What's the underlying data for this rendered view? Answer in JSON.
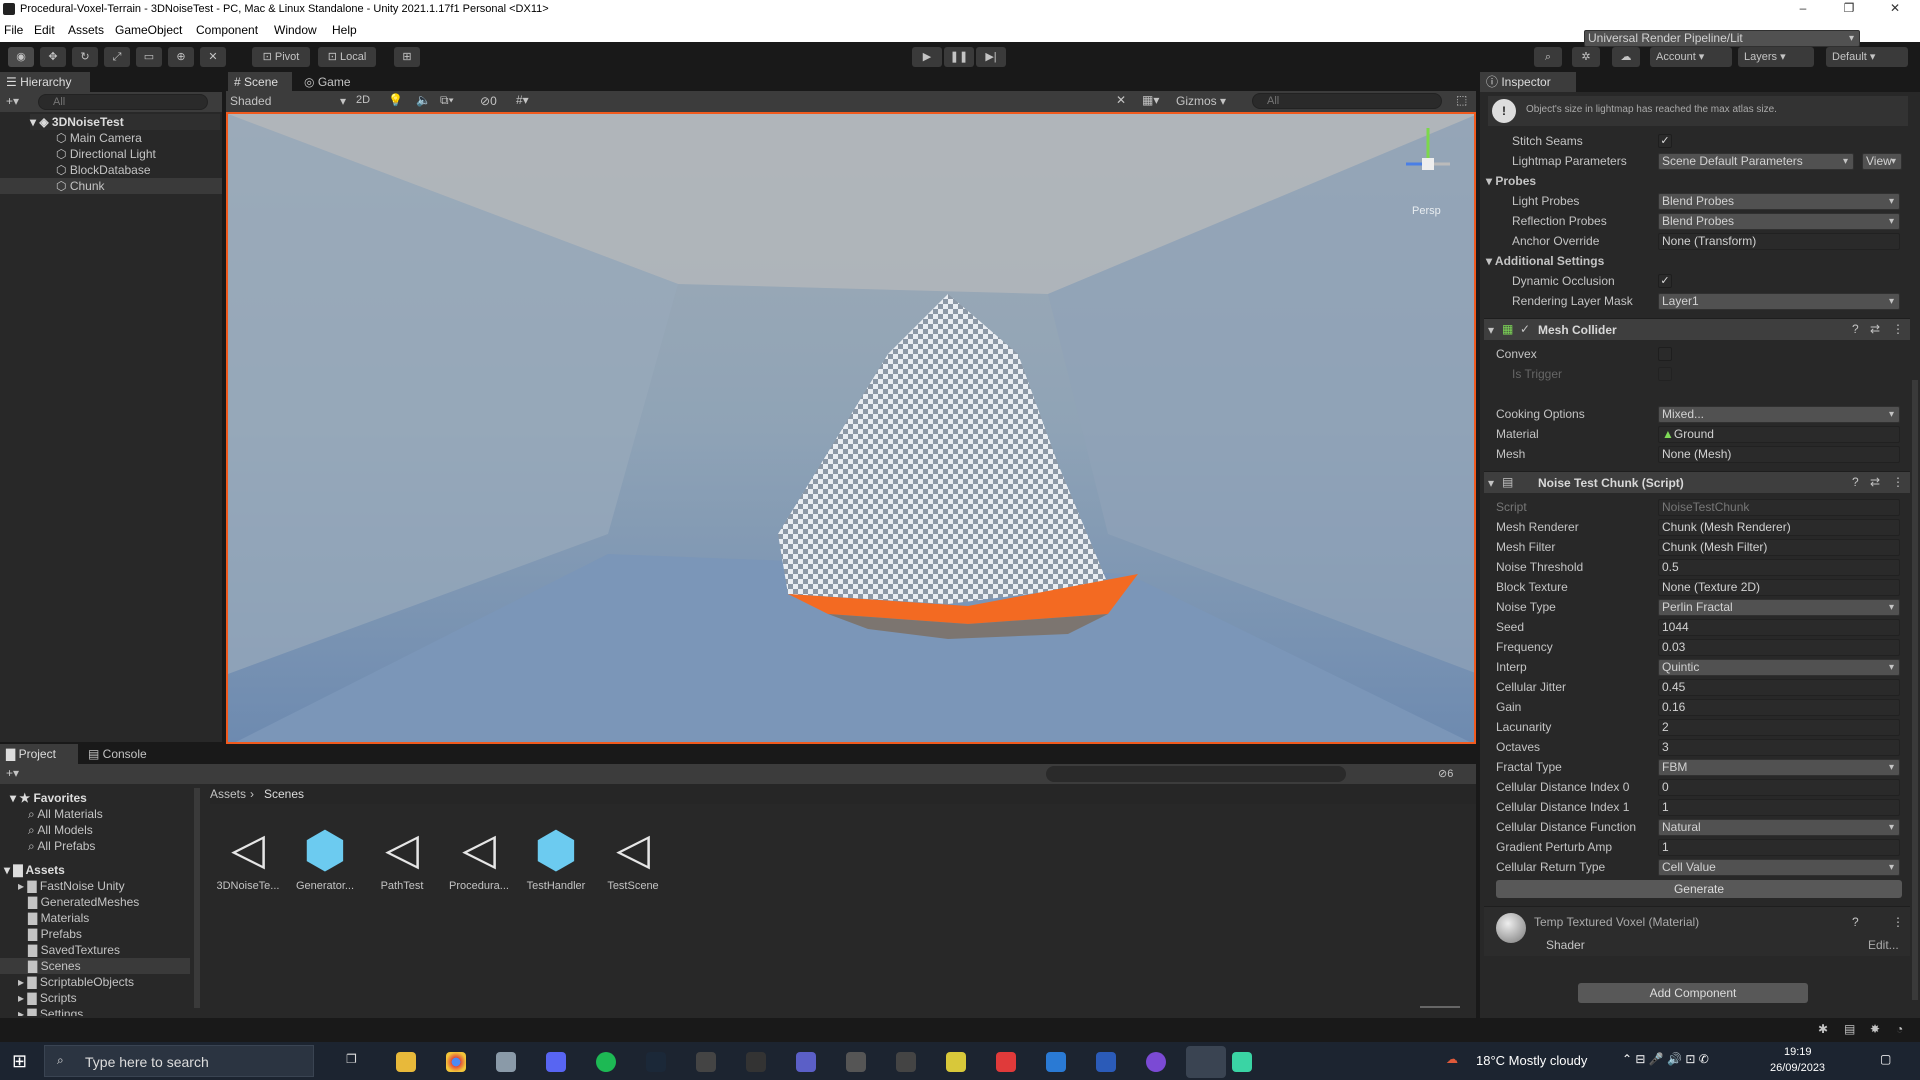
{
  "window": {
    "title": "Procedural-Voxel-Terrain - 3DNoiseTest - PC, Mac & Linux Standalone - Unity 2021.1.17f1 Personal <DX11>",
    "minimize": "–",
    "maximize": "❐",
    "close": "✕"
  },
  "menu": [
    "File",
    "Edit",
    "Assets",
    "GameObject",
    "Component",
    "Window",
    "Help"
  ],
  "toolbar": {
    "pivot": "Pivot",
    "local": "Local",
    "account": "Account",
    "layers": "Layers",
    "layout": "Default"
  },
  "hierarchy": {
    "tab": "Hierarchy",
    "search_placeholder": "All",
    "scene": "3DNoiseTest",
    "items": [
      "Main Camera",
      "Directional Light",
      "BlockDatabase",
      "Chunk"
    ]
  },
  "scene_view": {
    "tabs": [
      "Scene",
      "Game"
    ],
    "shading": "Shaded",
    "mode_2d": "2D",
    "hidden_count": "0",
    "gizmos": "Gizmos",
    "search_placeholder": "All",
    "persp": "Persp"
  },
  "project": {
    "tabs": [
      "Project",
      "Console"
    ],
    "breadcrumb": [
      "Assets",
      "Scenes"
    ],
    "hidden_count": "6",
    "favorites_label": "Favorites",
    "favorites": [
      "All Materials",
      "All Models",
      "All Prefabs"
    ],
    "assets_label": "Assets",
    "folders": [
      "FastNoise Unity",
      "GeneratedMeshes",
      "Materials",
      "Prefabs",
      "SavedTextures",
      "Scenes",
      "ScriptableObjects",
      "Scripts",
      "Settings"
    ],
    "files": [
      {
        "name": "3DNoiseTe...",
        "kind": "unity"
      },
      {
        "name": "Generator...",
        "kind": "prefab"
      },
      {
        "name": "PathTest",
        "kind": "unity"
      },
      {
        "name": "Procedura...",
        "kind": "unity"
      },
      {
        "name": "TestHandler",
        "kind": "prefab"
      },
      {
        "name": "TestScene",
        "kind": "unity"
      }
    ]
  },
  "inspector": {
    "tab": "Inspector",
    "warning": "Object's size in lightmap has reached the max atlas size.",
    "stitch_seams": "Stitch Seams",
    "lightmap_parameters": "Lightmap Parameters",
    "lightmap_parameters_value": "Scene Default Parameters",
    "view": "View",
    "probes": "Probes",
    "light_probes": "Light Probes",
    "light_probes_value": "Blend Probes",
    "reflection_probes": "Reflection Probes",
    "reflection_probes_value": "Blend Probes",
    "anchor_override": "Anchor Override",
    "anchor_override_value": "None (Transform)",
    "additional_settings": "Additional Settings",
    "dynamic_occlusion": "Dynamic Occlusion",
    "rendering_layer_mask": "Rendering Layer Mask",
    "rendering_layer_mask_value": "Layer1",
    "mesh_collider": {
      "title": "Mesh Collider",
      "convex": "Convex",
      "is_trigger": "Is Trigger",
      "cooking_options": "Cooking Options",
      "cooking_options_value": "Mixed...",
      "material": "Material",
      "material_value": "Ground",
      "mesh": "Mesh",
      "mesh_value": "None (Mesh)"
    },
    "noise_chunk": {
      "title": "Noise Test Chunk (Script)",
      "fields": [
        {
          "label": "Script",
          "value": "NoiseTestChunk",
          "type": "obj"
        },
        {
          "label": "Mesh Renderer",
          "value": "Chunk (Mesh Renderer)",
          "type": "obj"
        },
        {
          "label": "Mesh Filter",
          "value": "Chunk (Mesh Filter)",
          "type": "obj"
        },
        {
          "label": "Noise Threshold",
          "value": "0.5",
          "type": "text"
        },
        {
          "label": "Block Texture",
          "value": "None (Texture 2D)",
          "type": "obj"
        },
        {
          "label": "Noise Type",
          "value": "Perlin Fractal",
          "type": "drop"
        },
        {
          "label": "Seed",
          "value": "1044",
          "type": "text"
        },
        {
          "label": "Frequency",
          "value": "0.03",
          "type": "text"
        },
        {
          "label": "Interp",
          "value": "Quintic",
          "type": "drop"
        },
        {
          "label": "Cellular Jitter",
          "value": "0.45",
          "type": "text"
        },
        {
          "label": "Gain",
          "value": "0.16",
          "type": "text"
        },
        {
          "label": "Lacunarity",
          "value": "2",
          "type": "text"
        },
        {
          "label": "Octaves",
          "value": "3",
          "type": "text"
        },
        {
          "label": "Fractal Type",
          "value": "FBM",
          "type": "drop"
        },
        {
          "label": "Cellular Distance Index 0",
          "value": "0",
          "type": "text"
        },
        {
          "label": "Cellular Distance Index 1",
          "value": "1",
          "type": "text"
        },
        {
          "label": "Cellular Distance Function",
          "value": "Natural",
          "type": "drop"
        },
        {
          "label": "Gradient Perturb Amp",
          "value": "1",
          "type": "text"
        },
        {
          "label": "Cellular Return Type",
          "value": "Cell Value",
          "type": "drop"
        }
      ],
      "generate": "Generate"
    },
    "material": {
      "title": "Temp Textured Voxel (Material)",
      "shader_label": "Shader",
      "shader_value": "Universal Render Pipeline/Lit",
      "edit": "Edit..."
    },
    "add_component": "Add Component"
  },
  "taskbar": {
    "search_placeholder": "Type here to search",
    "weather": "18°C  Mostly cloudy",
    "time": "19:19",
    "date": "26/09/2023"
  }
}
